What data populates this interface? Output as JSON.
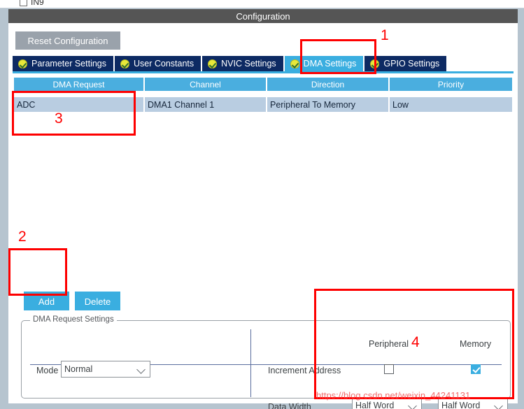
{
  "window": {
    "title": "Configuration"
  },
  "above": {
    "checkbox_label": "IN9"
  },
  "toolbar": {
    "reset_label": "Reset Configuration"
  },
  "tabs": [
    {
      "label": "Parameter Settings",
      "icon": "check-circle-icon",
      "active": false
    },
    {
      "label": "User Constants",
      "icon": "check-circle-icon",
      "active": false
    },
    {
      "label": "NVIC Settings",
      "icon": "check-circle-icon",
      "active": false
    },
    {
      "label": "DMA Settings",
      "icon": "check-circle-icon",
      "active": true
    },
    {
      "label": "GPIO Settings",
      "icon": "check-circle-icon",
      "active": false
    }
  ],
  "table": {
    "columns": [
      "DMA Request",
      "Channel",
      "Direction",
      "Priority"
    ],
    "rows": [
      [
        "ADC",
        "DMA1 Channel 1",
        "Peripheral To Memory",
        "Low"
      ]
    ]
  },
  "actions": {
    "add_label": "Add",
    "delete_label": "Delete"
  },
  "settings": {
    "legend": "DMA Request Settings",
    "mode_label": "Mode",
    "mode_value": "Normal",
    "increment_label": "Increment Address",
    "data_width_label": "Data Width",
    "col_peripheral": "Peripheral",
    "col_memory": "Memory",
    "peripheral_increment_checked": false,
    "memory_increment_checked": true,
    "peripheral_data_width": "Half Word",
    "memory_data_width": "Half Word"
  },
  "annotations": [
    {
      "number": "1"
    },
    {
      "number": "2"
    },
    {
      "number": "3"
    },
    {
      "number": "4"
    }
  ],
  "watermark": {
    "text": "https://blog.csdn.net/weixin_44241131"
  },
  "colors": {
    "titlebar": "#555555",
    "tab_inactive": "#0d2a63",
    "tab_active": "#3aaee0",
    "table_header": "#4aaedf",
    "row_selected": "#b9cde1",
    "accent": "#3aaee0",
    "annotation": "#fe0000"
  }
}
